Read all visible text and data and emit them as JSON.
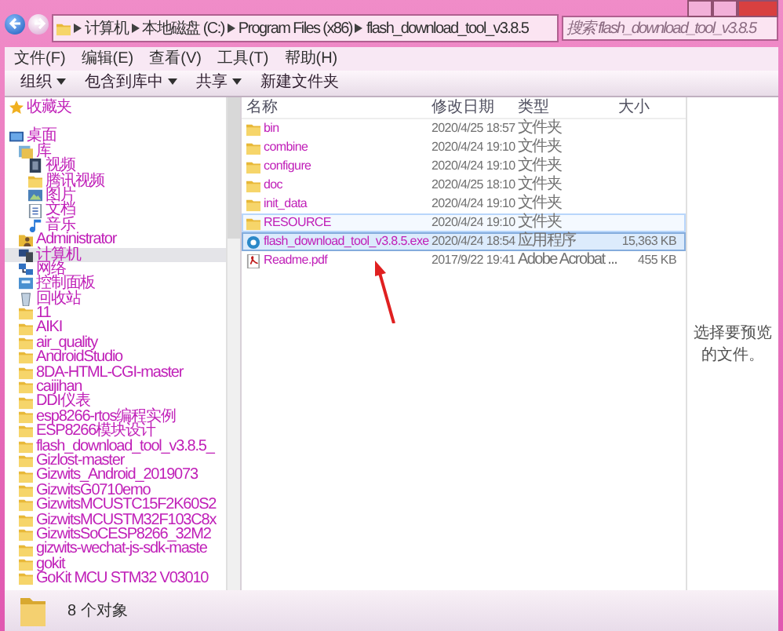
{
  "address": {
    "crumbs": [
      "计算机",
      "本地磁盘 (C:)",
      "Program Files (x86)",
      "flash_download_tool_v3.8.5"
    ]
  },
  "search": {
    "placeholder": "搜索 flash_download_tool_v3.8.5"
  },
  "menu": [
    "文件(F)",
    "编辑(E)",
    "查看(V)",
    "工具(T)",
    "帮助(H)"
  ],
  "toolbar": [
    {
      "label": "组织",
      "dropdown": true
    },
    {
      "label": "包含到库中",
      "dropdown": true
    },
    {
      "label": "共享",
      "dropdown": true
    },
    {
      "label": "新建文件夹",
      "dropdown": false
    }
  ],
  "columns": [
    "名称",
    "修改日期",
    "类型",
    "大小"
  ],
  "sidebar": {
    "favorites": {
      "label": "收藏夹",
      "kind": "star"
    },
    "items": [
      {
        "label": "桌面",
        "kind": "desktop",
        "selected": false,
        "children": [
          {
            "label": "库",
            "kind": "library",
            "selected": false,
            "children": [
              {
                "label": "视频",
                "kind": "video",
                "selected": false
              },
              {
                "label": "腾讯视频",
                "kind": "folder",
                "selected": false
              },
              {
                "label": "图片",
                "kind": "image",
                "selected": false
              },
              {
                "label": "文档",
                "kind": "doc",
                "selected": false
              },
              {
                "label": "音乐",
                "kind": "music",
                "selected": false
              }
            ]
          },
          {
            "label": "Administrator",
            "kind": "user",
            "selected": false
          },
          {
            "label": "计算机",
            "kind": "computer",
            "selected": true
          },
          {
            "label": "网络",
            "kind": "network",
            "selected": false
          },
          {
            "label": "控制面板",
            "kind": "control",
            "selected": false
          },
          {
            "label": "回收站",
            "kind": "recycle",
            "selected": false
          },
          {
            "label": "11",
            "kind": "folder",
            "selected": false
          },
          {
            "label": "AIKI",
            "kind": "folder",
            "selected": false
          },
          {
            "label": "air_quality",
            "kind": "folder",
            "selected": false
          },
          {
            "label": "AndroidStudio",
            "kind": "folder",
            "selected": false
          },
          {
            "label": "8DA-HTML-CGI-master",
            "kind": "folder",
            "selected": false
          },
          {
            "label": "caijihan",
            "kind": "folder",
            "selected": false
          },
          {
            "label": "DDI仪表",
            "kind": "folder",
            "selected": false
          },
          {
            "label": "esp8266-rtos编程实例",
            "kind": "folder",
            "selected": false
          },
          {
            "label": "ESP8266模块设计",
            "kind": "folder",
            "selected": false
          },
          {
            "label": "flash_download_tool_v3.8.5_",
            "kind": "folder",
            "selected": false
          },
          {
            "label": "Gizlost-master",
            "kind": "folder",
            "selected": false
          },
          {
            "label": "Gizwits_Android_2019073",
            "kind": "folder",
            "selected": false
          },
          {
            "label": "GizwitsG0710emo",
            "kind": "folder",
            "selected": false
          },
          {
            "label": "GizwitsMCUSTC15F2K60S2",
            "kind": "folder",
            "selected": false
          },
          {
            "label": "GizwitsMCUSTM32F103C8x",
            "kind": "folder",
            "selected": false
          },
          {
            "label": "GizwitsSoCESP8266_32M2",
            "kind": "folder",
            "selected": false
          },
          {
            "label": "gizwits-wechat-js-sdk-maste",
            "kind": "folder",
            "selected": false
          },
          {
            "label": "gokit",
            "kind": "folder",
            "selected": false
          },
          {
            "label": "GoKit MCU STM32 V03010",
            "kind": "folder",
            "selected": false
          }
        ]
      }
    ]
  },
  "files": [
    {
      "name": "bin",
      "date": "2020/4/25 18:57",
      "type": "文件夹",
      "kind": "folder",
      "selected": false,
      "hovered": false
    },
    {
      "name": "combine",
      "date": "2020/4/24 19:10",
      "type": "文件夹",
      "kind": "folder",
      "selected": false,
      "hovered": false
    },
    {
      "name": "configure",
      "date": "2020/4/24 19:10",
      "type": "文件夹",
      "kind": "folder",
      "selected": false,
      "hovered": false
    },
    {
      "name": "doc",
      "date": "2020/4/25 18:10",
      "type": "文件夹",
      "kind": "folder",
      "selected": false,
      "hovered": false
    },
    {
      "name": "init_data",
      "date": "2020/4/24 19:10",
      "type": "文件夹",
      "kind": "folder",
      "selected": false,
      "hovered": false
    },
    {
      "name": "RESOURCE",
      "date": "2020/4/24 19:10",
      "type": "文件夹",
      "kind": "folder",
      "selected": false,
      "hovered": true
    },
    {
      "name": "flash_download_tool_v3.8.5.exe",
      "date": "2020/4/24 18:54",
      "type": "应用程序",
      "size": "15,363 KB",
      "kind": "exe",
      "selected": true,
      "hovered": false
    },
    {
      "name": "Readme.pdf",
      "date": "2017/9/22 19:41",
      "type": "Adobe Acrobat ...",
      "size": "455 KB",
      "kind": "pdf",
      "selected": false,
      "hovered": false
    }
  ],
  "preview": {
    "message": "选择要预览的文件。"
  },
  "status_bar": {
    "count": "8 个对象"
  }
}
